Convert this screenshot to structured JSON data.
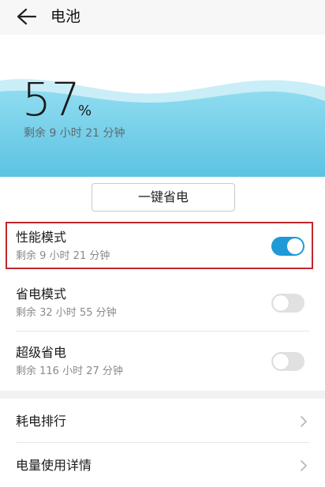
{
  "header": {
    "title": "电池",
    "back_icon": "arrow-left-icon"
  },
  "battery": {
    "level_percent": 57,
    "level_text": "57",
    "unit": "%",
    "remaining": "剩余 9 小时 21 分钟"
  },
  "one_key_save": {
    "label": "一键省电"
  },
  "modes": [
    {
      "label": "性能模式",
      "sub": "剩余 9 小时 21 分钟",
      "enabled": true
    },
    {
      "label": "省电模式",
      "sub": "剩余 32 小时 55 分钟",
      "enabled": false
    },
    {
      "label": "超级省电",
      "sub": "剩余 116 小时 27 分钟",
      "enabled": false
    }
  ],
  "nav": [
    {
      "label": "耗电排行",
      "icon": "chevron-right-icon"
    },
    {
      "label": "电量使用详情",
      "icon": "chevron-right-icon"
    }
  ],
  "colors": {
    "accent": "#1e9ad6",
    "wave": "#7ed3ea",
    "highlight_border": "#c0282d"
  }
}
